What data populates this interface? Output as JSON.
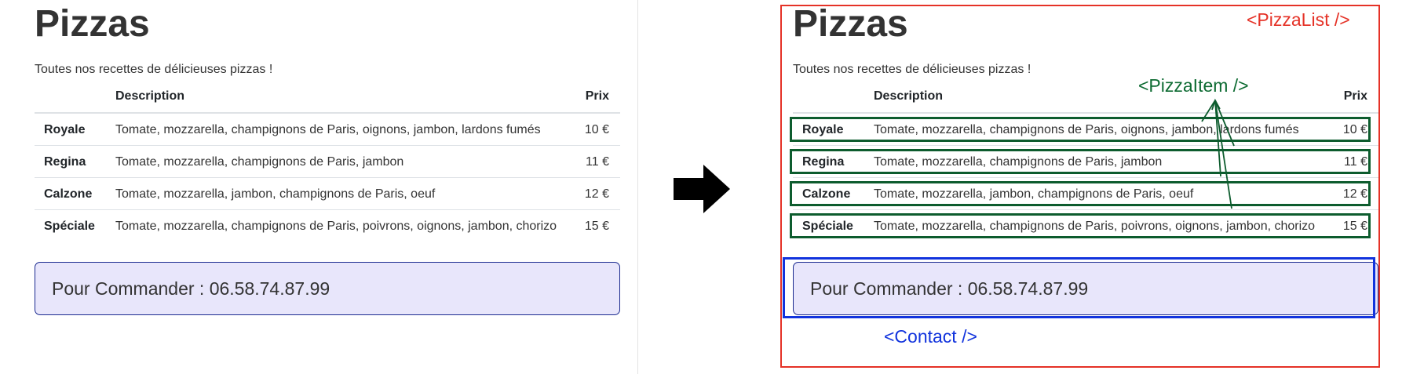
{
  "page": {
    "title": "Pizzas",
    "subtitle": "Toutes nos recettes de délicieuses pizzas !",
    "headers": {
      "description": "Description",
      "price": "Prix"
    },
    "pizzas": [
      {
        "name": "Royale",
        "description": "Tomate, mozzarella, champignons de Paris, oignons, jambon, lardons fumés",
        "price": "10 €"
      },
      {
        "name": "Regina",
        "description": "Tomate, mozzarella, champignons de Paris, jambon",
        "price": "11 €"
      },
      {
        "name": "Calzone",
        "description": "Tomate, mozzarella, jambon, champignons de Paris, oeuf",
        "price": "12 €"
      },
      {
        "name": "Spéciale",
        "description": "Tomate, mozzarella, champignons de Paris, poivrons, oignons, jambon, chorizo",
        "price": "15 €"
      }
    ],
    "contact": "Pour Commander : 06.58.74.87.99"
  },
  "annotations": {
    "pizza_list": "<PizzaList />",
    "pizza_item": "<PizzaItem />",
    "contact": "<Contact />"
  },
  "colors": {
    "pizza_list": "#e53227",
    "pizza_item": "#0d5c2e",
    "contact": "#1133dd",
    "contact_background": "#e8e6fb"
  }
}
